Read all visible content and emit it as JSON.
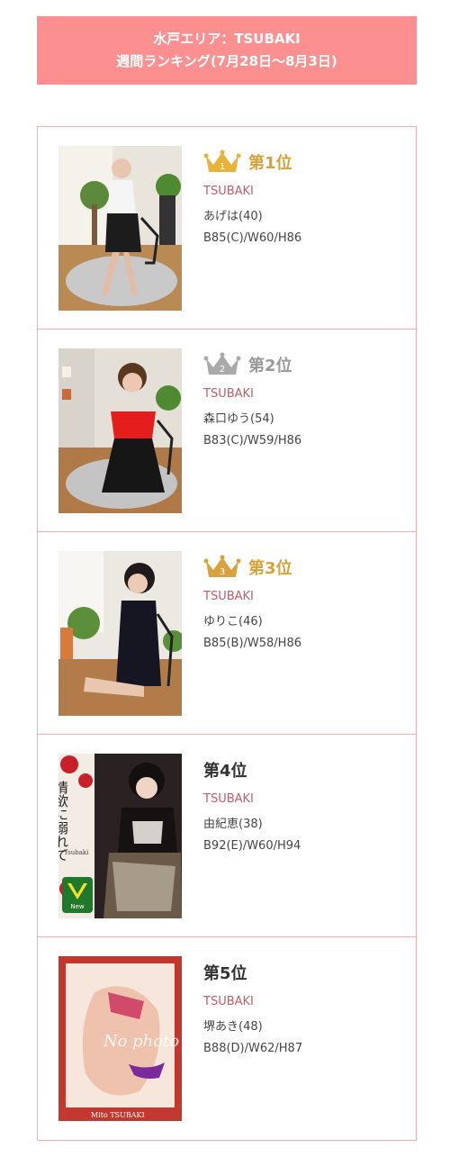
{
  "header": {
    "line1": "水戸エリア：TSUBAKI",
    "line2": "週間ランキング(7月28日〜8月3日)"
  },
  "entries": [
    {
      "rank": "第1位",
      "crown_num": "1",
      "crown": "gold",
      "shop": "TSUBAKI",
      "name": "あげは(40)",
      "size": "B85(C)/W60/H86"
    },
    {
      "rank": "第2位",
      "crown_num": "2",
      "crown": "silver",
      "shop": "TSUBAKI",
      "name": "森口ゆう(54)",
      "size": "B83(C)/W59/H86"
    },
    {
      "rank": "第3位",
      "crown_num": "3",
      "crown": "bronze",
      "shop": "TSUBAKI",
      "name": "ゆりこ(46)",
      "size": "B85(B)/W58/H86"
    },
    {
      "rank": "第4位",
      "shop": "TSUBAKI",
      "name": "由紀恵(38)",
      "size": "B92(E)/W60/H94"
    },
    {
      "rank": "第5位",
      "shop": "TSUBAKI",
      "name": "堺あき(48)",
      "size": "B88(D)/W62/H87"
    }
  ],
  "photo4": {
    "title": "情欲に溺れて",
    "sub": "Tsubaki",
    "badge": "New"
  },
  "photo5": {
    "watermark": "No photo",
    "caption": "Mito TSUBAKI"
  },
  "colors": {
    "header": "#fc9090",
    "border": "#f2aeb0",
    "gold": "#e9b23a",
    "silver": "#a9a9a9",
    "bronze": "#d9a23c",
    "shop": "#c45a6a"
  }
}
